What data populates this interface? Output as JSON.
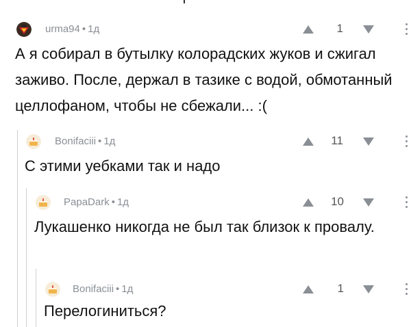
{
  "comments": [
    {
      "author": "urma94",
      "age": "1д",
      "score": "1",
      "avatar": "superman-avatar",
      "text": "А я собирал в бутылку колорадских жуков и сжигал заживо. После, держал в тазике с водой, обмотанный целлофаном, чтобы не сбежали... :("
    },
    {
      "author": "Bonifaciii",
      "age": "1д",
      "score": "11",
      "avatar": "cake-avatar",
      "text": "С этими уебками так и надо"
    },
    {
      "author": "PapaDark",
      "age": "1д",
      "score": "10",
      "avatar": "cake-avatar",
      "text": "Лукашенко никогда не был так близок к провалу."
    },
    {
      "author": "Bonifaciii",
      "age": "1д",
      "score": "1",
      "avatar": "cake-avatar",
      "text": "Перелогиниться?"
    }
  ],
  "colors": {
    "meta": "#8a8f95",
    "vote": "#8a8f95",
    "thread_line": "#cfcfcf"
  },
  "separator": "•"
}
